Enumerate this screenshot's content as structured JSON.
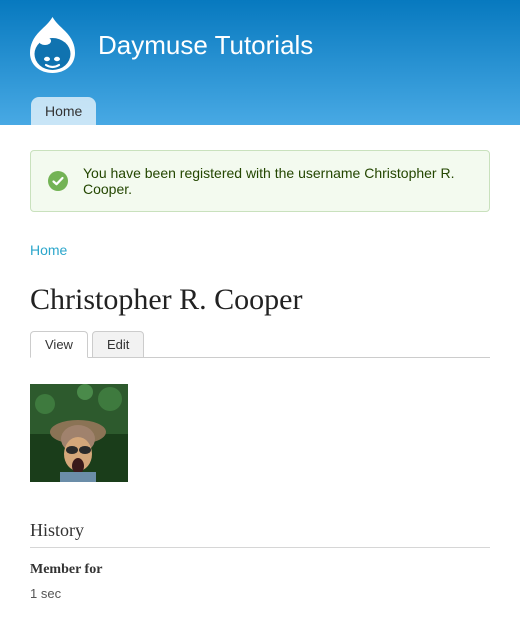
{
  "site": {
    "name": "Daymuse Tutorials"
  },
  "nav": {
    "home_label": "Home"
  },
  "status": {
    "message": "You have been registered with the username Christopher R. Cooper."
  },
  "breadcrumb": {
    "home_label": "Home"
  },
  "page": {
    "title": "Christopher R. Cooper"
  },
  "tabs": {
    "view_label": "View",
    "edit_label": "Edit"
  },
  "history": {
    "heading": "History",
    "member_for_label": "Member for",
    "member_for_value": "1 sec"
  }
}
